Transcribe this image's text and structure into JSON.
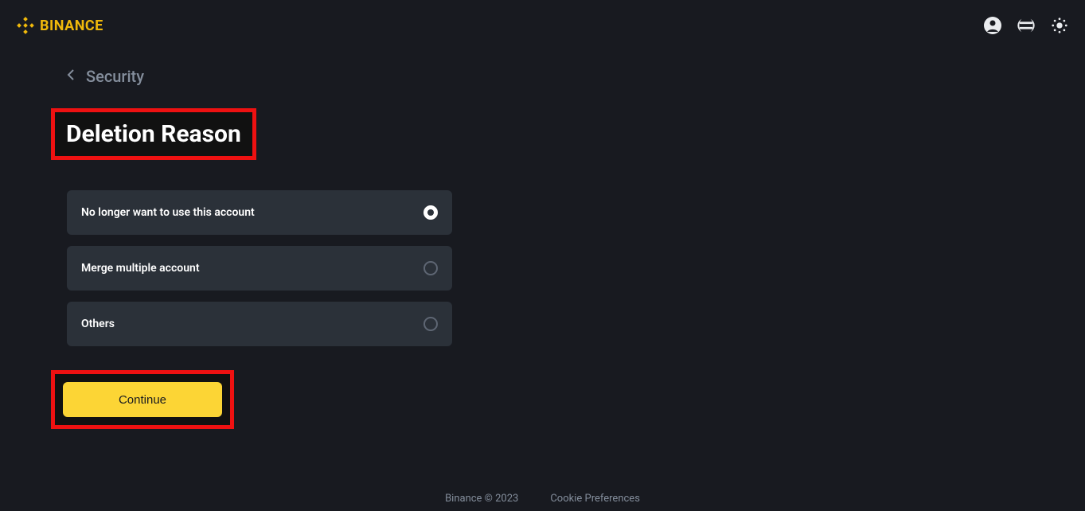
{
  "header": {
    "brand": "BINANCE"
  },
  "breadcrumb": {
    "label": "Security"
  },
  "page": {
    "title": "Deletion Reason",
    "options": [
      {
        "label": "No longer want to use this account",
        "selected": true
      },
      {
        "label": "Merge multiple account",
        "selected": false
      },
      {
        "label": "Others",
        "selected": false
      }
    ],
    "continue_label": "Continue"
  },
  "footer": {
    "copyright": "Binance © 2023",
    "cookie_link": "Cookie Preferences"
  }
}
